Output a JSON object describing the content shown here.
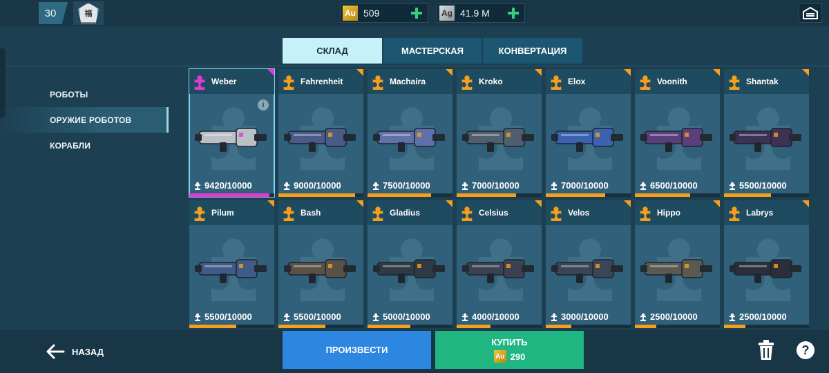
{
  "topbar": {
    "level": "30",
    "emblem_text": "福",
    "gold": {
      "code": "Au",
      "value": "509",
      "color": "#f1c43b"
    },
    "silver": {
      "code": "Ag",
      "value": "41.9 M",
      "color": "#c9d0d3"
    }
  },
  "tabs": [
    {
      "label": "СКЛАД",
      "active": true
    },
    {
      "label": "МАСТЕРСКАЯ",
      "active": false
    },
    {
      "label": "КОНВЕРТАЦИЯ",
      "active": false
    }
  ],
  "sidenav": [
    {
      "label": "РОБОТЫ",
      "active": false
    },
    {
      "label": "ОРУЖИЕ РОБОТОВ",
      "active": true
    },
    {
      "label": "КОРАБЛИ",
      "active": false
    }
  ],
  "items": [
    {
      "name": "Weber",
      "count": "9420/10000",
      "progress": 0.942,
      "rarity_color": "#e33ad6",
      "weapon_color": "#b9c1c7",
      "selected": true
    },
    {
      "name": "Fahrenheit",
      "count": "9000/10000",
      "progress": 0.9,
      "rarity_color": "#f59f1d",
      "weapon_color": "#4a5b88",
      "selected": false
    },
    {
      "name": "Machaira",
      "count": "7500/10000",
      "progress": 0.75,
      "rarity_color": "#f59f1d",
      "weapon_color": "#6070a8",
      "selected": false
    },
    {
      "name": "Kroko",
      "count": "7000/10000",
      "progress": 0.7,
      "rarity_color": "#f59f1d",
      "weapon_color": "#4f5f6e",
      "selected": false
    },
    {
      "name": "Elox",
      "count": "7000/10000",
      "progress": 0.7,
      "rarity_color": "#f59f1d",
      "weapon_color": "#3a62b0",
      "selected": false
    },
    {
      "name": "Voonith",
      "count": "6500/10000",
      "progress": 0.65,
      "rarity_color": "#f59f1d",
      "weapon_color": "#5a3f7a",
      "selected": false
    },
    {
      "name": "Shantak",
      "count": "5500/10000",
      "progress": 0.55,
      "rarity_color": "#f59f1d",
      "weapon_color": "#3d3155",
      "selected": false
    },
    {
      "name": "Pilum",
      "count": "5500/10000",
      "progress": 0.55,
      "rarity_color": "#f59f1d",
      "weapon_color": "#3f5b86",
      "selected": false
    },
    {
      "name": "Bash",
      "count": "5500/10000",
      "progress": 0.55,
      "rarity_color": "#f59f1d",
      "weapon_color": "#5a5146",
      "selected": false
    },
    {
      "name": "Gladius",
      "count": "5000/10000",
      "progress": 0.5,
      "rarity_color": "#f59f1d",
      "weapon_color": "#2f3a45",
      "selected": false
    },
    {
      "name": "Celsius",
      "count": "4000/10000",
      "progress": 0.4,
      "rarity_color": "#f59f1d",
      "weapon_color": "#3b4150",
      "selected": false
    },
    {
      "name": "Velos",
      "count": "3000/10000",
      "progress": 0.3,
      "rarity_color": "#f59f1d",
      "weapon_color": "#3a4656",
      "selected": false
    },
    {
      "name": "Hippo",
      "count": "2500/10000",
      "progress": 0.25,
      "rarity_color": "#f59f1d",
      "weapon_color": "#5a5a52",
      "selected": false
    },
    {
      "name": "Labrys",
      "count": "2500/10000",
      "progress": 0.25,
      "rarity_color": "#f59f1d",
      "weapon_color": "#2c2f3a",
      "selected": false
    }
  ],
  "info_icon": "i",
  "bottom": {
    "back_label": "НАЗАД",
    "produce_label": "ПРОИЗВЕСТИ",
    "buy_label": "КУПИТЬ",
    "buy_price": "290",
    "buy_currency": "Au",
    "help_label": "?"
  },
  "colors": {
    "accent_orange": "#f59f1d",
    "accent_magenta": "#e33ad6",
    "produce": "#2d86e0",
    "buy": "#1fb682"
  },
  "icons": [
    "garage-icon",
    "plus-icon",
    "puzzle-piece-icon",
    "info-icon",
    "back-arrow-icon",
    "trash-icon",
    "help-icon"
  ]
}
